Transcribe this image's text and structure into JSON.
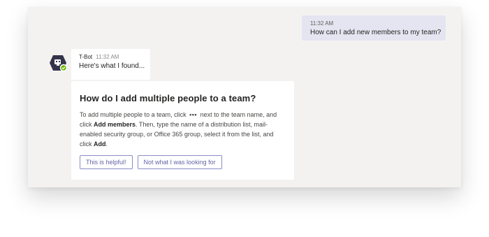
{
  "user_message": {
    "time": "11:32 AM",
    "text": "How can I add new members to my team?"
  },
  "bot_message": {
    "sender": "T-Bot",
    "time": "11:32 AM",
    "text": "Here's what I found..."
  },
  "card": {
    "title": "How do I add multiple people to a team?",
    "body_part1": "To add multiple people to a team, click",
    "more_icon_glyph": "•••",
    "body_part2": "next to the team name, and click",
    "add_members": "Add members",
    "body_part3": ". Then, type the name of a distribution list, mail-enabled security group, or Office 365 group, select it from the list, and click",
    "add": "Add",
    "body_part4": "."
  },
  "actions": {
    "helpful_label": "This is helpful!",
    "not_helpful_label": "Not what I was looking for"
  },
  "icons": {
    "avatar": "bot-avatar-icon",
    "status": "available-check-icon",
    "more": "more-options-icon"
  },
  "colors": {
    "accent": "#6264a7",
    "user_bubble": "#e5e5f1",
    "status_green": "#6bb700",
    "avatar_dark": "#33344a"
  }
}
